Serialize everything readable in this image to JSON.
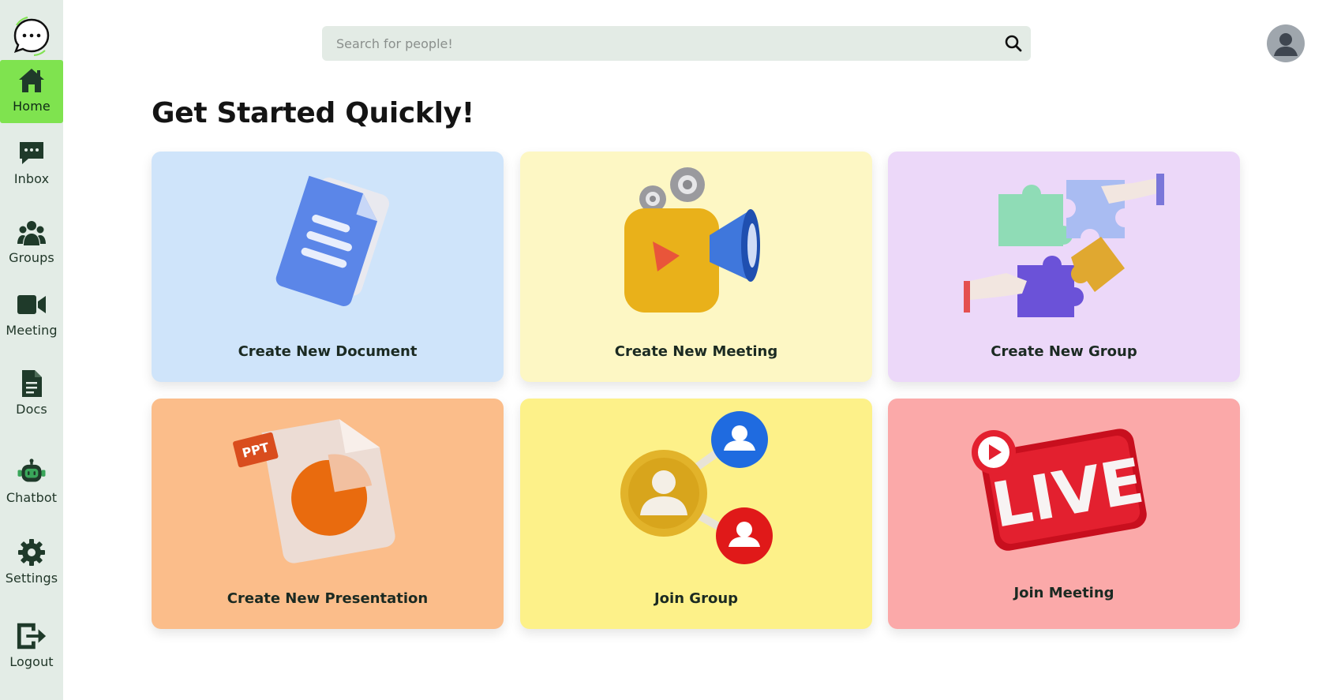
{
  "sidebar": {
    "items": [
      {
        "label": "Home",
        "icon": "home-icon"
      },
      {
        "label": "Inbox",
        "icon": "inbox-icon"
      },
      {
        "label": "Groups",
        "icon": "groups-icon"
      },
      {
        "label": "Meeting",
        "icon": "video-icon"
      },
      {
        "label": "Docs",
        "icon": "document-icon"
      },
      {
        "label": "Chatbot",
        "icon": "robot-icon"
      },
      {
        "label": "Settings",
        "icon": "gear-icon"
      },
      {
        "label": "Logout",
        "icon": "logout-icon"
      }
    ],
    "active": "Home",
    "active_color": "#7fe34f"
  },
  "header": {
    "search_placeholder": "Search for people!",
    "search_value": ""
  },
  "main": {
    "title": "Get Started Quickly!",
    "cards": [
      {
        "label": "Create New Document",
        "color": "#cfe4fa",
        "icon": "document-3d-icon"
      },
      {
        "label": "Create New Meeting",
        "color": "#fdf7c4",
        "icon": "video-camera-3d-icon"
      },
      {
        "label": "Create New Group",
        "color": "#ecd8f9",
        "icon": "puzzle-3d-icon"
      },
      {
        "label": "Create New Presentation",
        "color": "#fbbd8a",
        "icon": "ppt-file-3d-icon"
      },
      {
        "label": "Join Group",
        "color": "#fdf189",
        "icon": "user-network-3d-icon"
      },
      {
        "label": "Join Meeting",
        "color": "#fba9a9",
        "icon": "live-badge-3d-icon"
      }
    ],
    "live_text": "LIVE",
    "ppt_text": "PPT"
  }
}
